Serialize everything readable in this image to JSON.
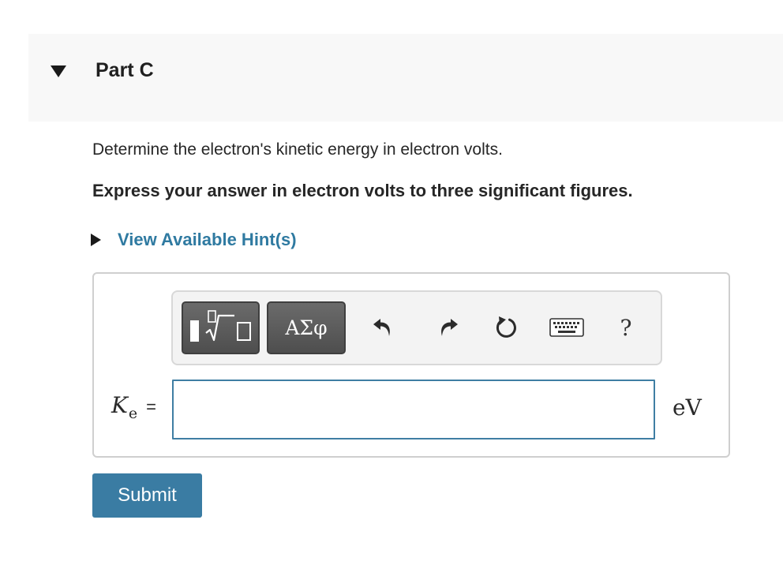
{
  "part": {
    "title": "Part C"
  },
  "question": {
    "prompt": "Determine the electron's kinetic energy in electron volts.",
    "instruction": "Express your answer in electron volts to three significant figures."
  },
  "hints": {
    "label": "View Available Hint(s)"
  },
  "toolbar": {
    "greek_label": "ΑΣφ",
    "help_label": "?",
    "icons": {
      "templates": "templates-icon",
      "undo": "undo-icon",
      "redo": "redo-icon",
      "reset": "reset-icon",
      "keyboard": "keyboard-icon"
    }
  },
  "answer": {
    "variable": "K",
    "subscript": "e",
    "equals": "=",
    "value": "",
    "unit": "eV"
  },
  "submit": {
    "label": "Submit"
  },
  "colors": {
    "accent": "#3a7ca3",
    "hint_link": "#2f7aa1",
    "header_bg": "#f8f8f8",
    "toolbar_button": "#5a5a5a"
  }
}
